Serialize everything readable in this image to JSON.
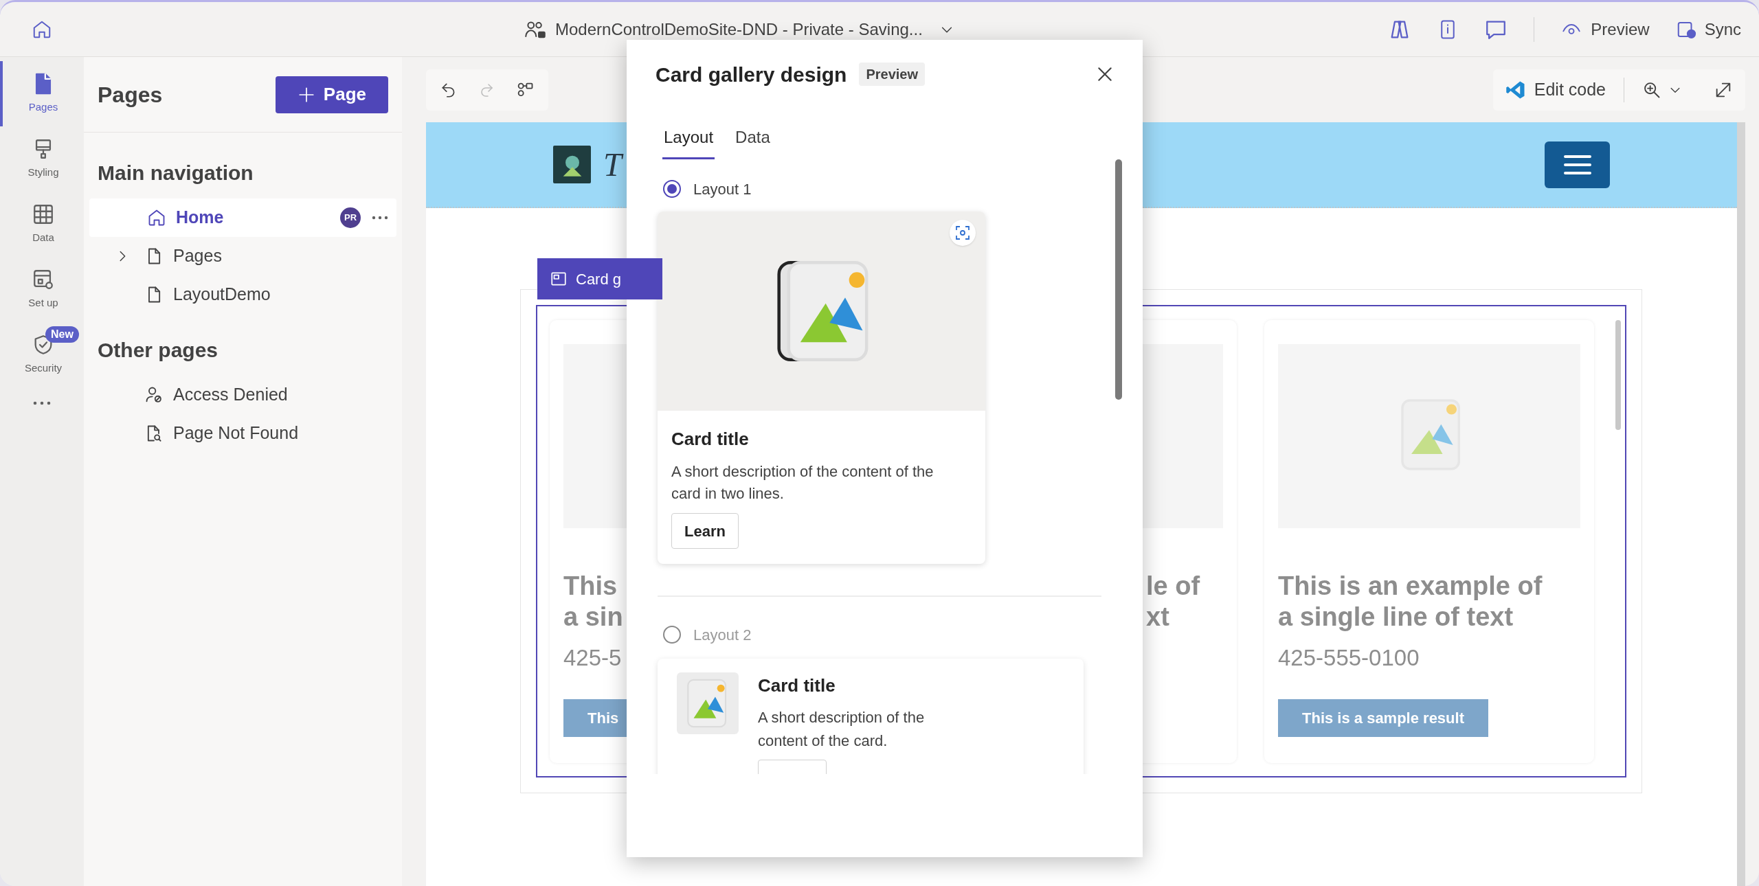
{
  "title_bar": {
    "title": "ModernControlDemoSite-DND - Private - Saving...",
    "actions": [
      {
        "label": "Preview",
        "kind": "preview"
      },
      {
        "label": "Sync",
        "kind": "sync"
      }
    ]
  },
  "rail": [
    {
      "label": "Pages",
      "kind": "pages",
      "selected": true
    },
    {
      "label": "Styling",
      "kind": "styling",
      "selected": false
    },
    {
      "label": "Data",
      "kind": "data",
      "selected": false
    },
    {
      "label": "Set up",
      "kind": "setup",
      "selected": false
    },
    {
      "label": "Security",
      "kind": "security",
      "selected": false,
      "badge": "New"
    }
  ],
  "pages_panel": {
    "title": "Pages",
    "add_button": "Page",
    "sections": [
      {
        "heading": "Main navigation",
        "items": [
          {
            "label": "Home",
            "kind": "home",
            "selected": true,
            "avatar": "PR"
          },
          {
            "label": "Pages",
            "kind": "page",
            "selected": false,
            "expanded": false
          },
          {
            "label": "LayoutDemo",
            "kind": "page",
            "selected": false
          }
        ]
      },
      {
        "heading": "Other pages",
        "items": [
          {
            "label": "Access Denied",
            "kind": "person",
            "selected": false
          },
          {
            "label": "Page Not Found",
            "kind": "pagesearch",
            "selected": false
          }
        ]
      }
    ]
  },
  "canvas": {
    "edit_code": "Edit code",
    "site": {
      "brand_text": "T",
      "component_tab": "Card g",
      "cards": [
        {
          "title_lines": [
            "This",
            "a sin"
          ],
          "phone": "425-5",
          "button": "This"
        },
        {
          "title_lines": [
            "le of",
            "xt"
          ]
        },
        {
          "title_lines": [
            "This is an example of",
            "a single line of text"
          ],
          "phone": "425-555-0100",
          "button": "This is a sample result"
        }
      ]
    }
  },
  "dialog": {
    "title": "Card gallery design",
    "badge": "Preview",
    "tabs": [
      {
        "label": "Layout",
        "selected": true
      },
      {
        "label": "Data",
        "selected": false
      }
    ],
    "layouts": [
      {
        "label": "Layout 1",
        "selected": true,
        "kind": "stacked",
        "card": {
          "title": "Card title",
          "description": "A short description of the content of the card in two lines.",
          "button": "Learn"
        }
      },
      {
        "label": "Layout 2",
        "selected": false,
        "kind": "side",
        "card": {
          "title": "Card title",
          "description": "A short description of the content of the card."
        }
      }
    ]
  }
}
